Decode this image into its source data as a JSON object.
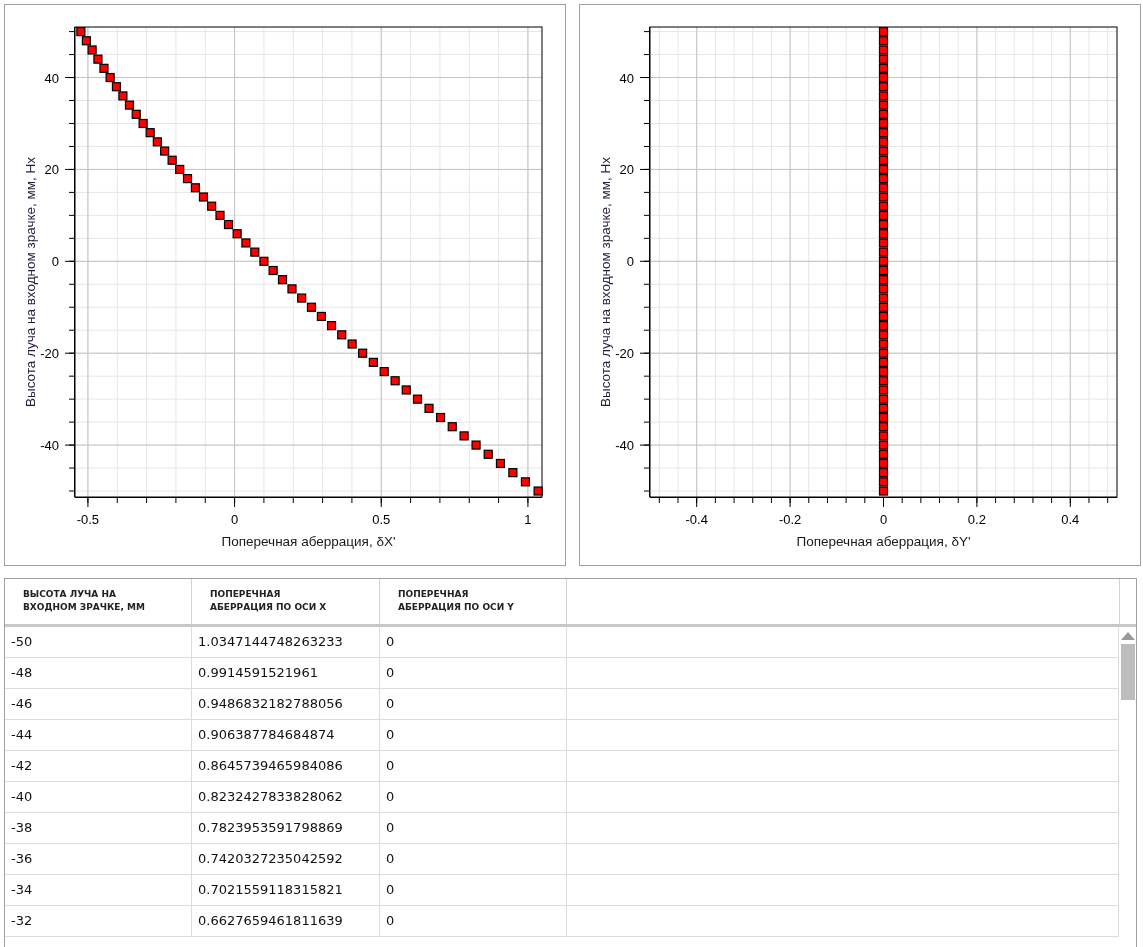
{
  "charts": [
    {
      "chart_data": {
        "type": "scatter",
        "xlabel": "Поперечная аберрация, δX'",
        "ylabel": "Высота луча на входном зрачке, мм, Hx",
        "x": [
          1.0347,
          0.9915,
          0.9487,
          0.9064,
          0.8646,
          0.8232,
          0.7824,
          0.742,
          0.7022,
          0.6628,
          0.6236,
          0.5852,
          0.5473,
          0.51,
          0.4731,
          0.4366,
          0.4007,
          0.3653,
          0.3305,
          0.296,
          0.2621,
          0.2287,
          0.1957,
          0.1634,
          0.1314,
          0.1,
          0.069,
          0.0386,
          0.0087,
          -0.0207,
          -0.0497,
          -0.0782,
          -0.1061,
          -0.1335,
          -0.1605,
          -0.187,
          -0.2129,
          -0.2384,
          -0.2633,
          -0.2878,
          -0.3118,
          -0.3353,
          -0.3583,
          -0.3807,
          -0.4027,
          -0.4242,
          -0.4453,
          -0.4658,
          -0.4857,
          -0.5052,
          -0.524
        ],
        "series": [
          {
            "color": "#ff0000",
            "values": [
              -50,
              -48,
              -46,
              -44,
              -42,
              -40,
              -38,
              -36,
              -34,
              -32,
              -30,
              -28,
              -26,
              -24,
              -22,
              -20,
              -18,
              -16,
              -14,
              -12,
              -10,
              -8,
              -6,
              -4,
              -2,
              0,
              2,
              4,
              6,
              8,
              10,
              12,
              14,
              16,
              18,
              20,
              22,
              24,
              26,
              28,
              30,
              32,
              34,
              36,
              38,
              40,
              42,
              44,
              46,
              48,
              50
            ]
          }
        ],
        "grid": true,
        "xlim": [
          -0.544,
          1.048
        ],
        "ylim": [
          -51.3,
          51
        ],
        "xticks": [
          -0.5,
          0,
          0.5,
          1
        ],
        "yticks": [
          -40,
          -20,
          0,
          20,
          40
        ]
      }
    },
    {
      "chart_data": {
        "type": "scatter",
        "xlabel": "Поперечная аберрация, δY'",
        "ylabel": "Высота луча на входном зрачке, мм, Hx",
        "x": [
          0,
          0,
          0,
          0,
          0,
          0,
          0,
          0,
          0,
          0,
          0,
          0,
          0,
          0,
          0,
          0,
          0,
          0,
          0,
          0,
          0,
          0,
          0,
          0,
          0,
          0,
          0,
          0,
          0,
          0,
          0,
          0,
          0,
          0,
          0,
          0,
          0,
          0,
          0,
          0,
          0,
          0,
          0,
          0,
          0,
          0,
          0,
          0,
          0,
          0,
          0
        ],
        "series": [
          {
            "color": "#ff0000",
            "values": [
              -50,
              -48,
              -46,
              -44,
              -42,
              -40,
              -38,
              -36,
              -34,
              -32,
              -30,
              -28,
              -26,
              -24,
              -22,
              -20,
              -18,
              -16,
              -14,
              -12,
              -10,
              -8,
              -6,
              -4,
              -2,
              0,
              2,
              4,
              6,
              8,
              10,
              12,
              14,
              16,
              18,
              20,
              22,
              24,
              26,
              28,
              30,
              32,
              34,
              36,
              38,
              40,
              42,
              44,
              46,
              48,
              50
            ]
          }
        ],
        "grid": true,
        "xlim": [
          -0.5,
          0.5
        ],
        "ylim": [
          -51.3,
          51
        ],
        "xticks": [
          -0.4,
          -0.2,
          0,
          0.2,
          0.4
        ],
        "yticks": [
          -40,
          -20,
          0,
          20,
          40
        ]
      }
    }
  ],
  "table": {
    "columns": [
      "ВЫСОТА ЛУЧА НА ВХОДНОМ ЗРАЧКЕ, ММ",
      "ПОПЕРЕЧНАЯ АБЕРРАЦИЯ ПО ОСИ X",
      "ПОПЕРЕЧНАЯ АБЕРРАЦИЯ ПО ОСИ Y"
    ],
    "rows": [
      [
        "-50",
        "1.0347144748263233",
        "0"
      ],
      [
        "-48",
        "0.9914591521961",
        "0"
      ],
      [
        "-46",
        "0.9486832182788056",
        "0"
      ],
      [
        "-44",
        "0.906387784684874",
        "0"
      ],
      [
        "-42",
        "0.8645739465984086",
        "0"
      ],
      [
        "-40",
        "0.8232427833828062",
        "0"
      ],
      [
        "-38",
        "0.7823953591798869",
        "0"
      ],
      [
        "-36",
        "0.7420327235042592",
        "0"
      ],
      [
        "-34",
        "0.7021559118315821",
        "0"
      ],
      [
        "-32",
        "0.6627659461811639",
        "0"
      ]
    ]
  }
}
